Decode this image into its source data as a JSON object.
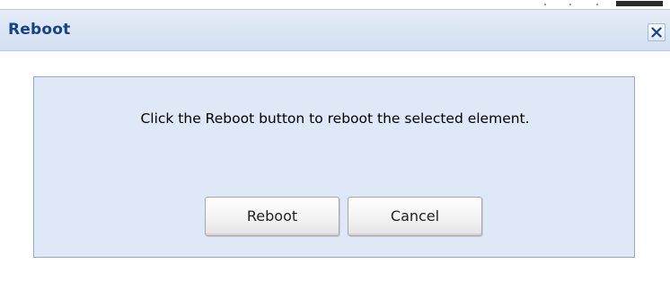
{
  "dialog": {
    "title": "Reboot",
    "close_icon": "close-icon",
    "message": "Click the Reboot button to reboot the selected element.",
    "buttons": {
      "reboot_label": "Reboot",
      "cancel_label": "Cancel"
    }
  },
  "colors": {
    "title_text": "#15428b",
    "titlebar_bg": "#d3e0f1",
    "panel_bg": "#dfe8f6",
    "panel_border": "#8eaace"
  }
}
